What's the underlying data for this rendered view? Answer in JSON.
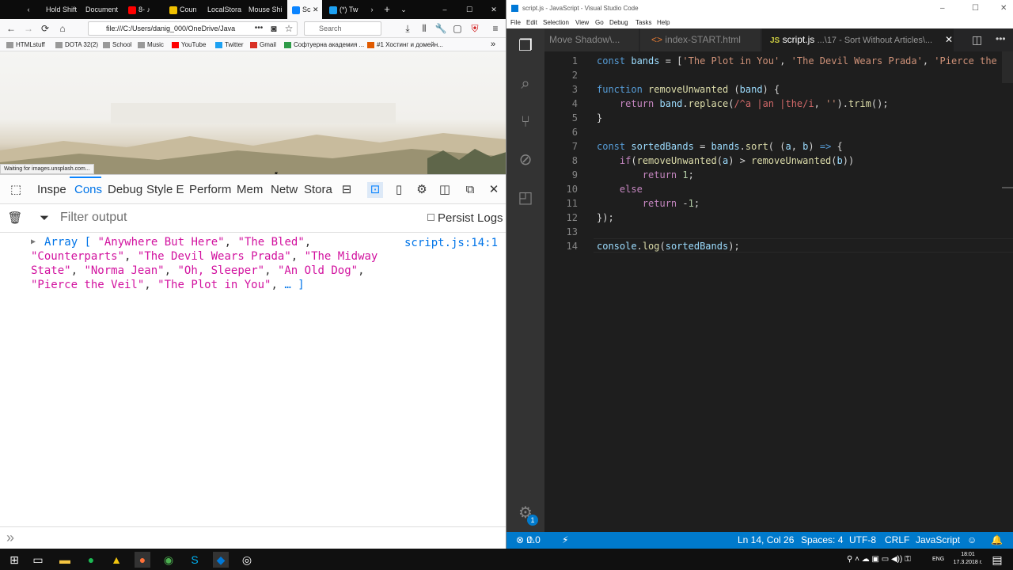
{
  "firefox": {
    "tabs": [
      {
        "label": "Hold Shift",
        "color": "#3c3c3c"
      },
      {
        "label": "Document",
        "color": "#3c3c3c"
      },
      {
        "label": "8-",
        "color": "#ff0000"
      },
      {
        "label": "Coun",
        "color": "#f0c000"
      },
      {
        "label": "LocalStora",
        "color": "#3c3c3c"
      },
      {
        "label": "Mouse Shi",
        "color": "#3c3c3c"
      },
      {
        "label": "Sc",
        "color": "#3c3c3c"
      },
      {
        "label": "(*) Tw",
        "color": "#1da1f2"
      }
    ],
    "url": "file:///C:/Users/danig_000/OneDrive/Java",
    "search_placeholder": "Search",
    "bookmarks": [
      "HTMLstuff",
      "DOTA 32(2)",
      "School",
      "Music",
      "YouTube",
      "Twitter",
      "Gmail",
      "Софтуерна академия ...",
      "#1 Хостинг и домейн..."
    ],
    "status_message": "Waiting for images.unsplash.com...",
    "devtools_tabs": [
      "Inspe",
      "Cons",
      "Debug",
      "Style E",
      "Perform",
      "Mem",
      "Netw",
      "Stora"
    ],
    "filter_placeholder": "Filter output",
    "persist_logs": "Persist Logs",
    "console_output": {
      "prefix": "Array [",
      "items": [
        "\"Anywhere But Here\"",
        "\"The Bled\"",
        "\"Counterparts\"",
        "\"The Devil Wears Prada\"",
        "\"The Midway",
        "State\"",
        "\"Norma Jean\"",
        "\"Oh, Sleeper\"",
        "\"An Old Dog\"",
        "\"Pierce the Veil\"",
        "\"The Plot in You\""
      ],
      "suffix": "… ]",
      "location": "script.js:14:1"
    },
    "prompt_symbol": "»"
  },
  "vscode": {
    "title": "script.js - JavaScript - Visual Studio Code",
    "menu": [
      "File",
      "Edit",
      "Selection",
      "View",
      "Go",
      "Debug",
      "Tasks",
      "Help"
    ],
    "tabs": [
      {
        "label": "Move Shadow\\..."
      },
      {
        "label": "index-START.html"
      },
      {
        "label": "script.js",
        "path": "...\\17 - Sort Without Articles\\..."
      }
    ],
    "line_numbers": [
      "1",
      "2",
      "3",
      "4",
      "5",
      "6",
      "7",
      "8",
      "9",
      "10",
      "11",
      "12",
      "13",
      "14"
    ],
    "status": {
      "errors": "0",
      "warnings": "0",
      "position": "Ln 14, Col 26",
      "spaces": "Spaces: 4",
      "encoding": "UTF-8",
      "eol": "CRLF",
      "language": "JavaScript"
    },
    "badge": "1"
  },
  "taskbar": {
    "language": "ENG",
    "time": "18:01",
    "date": "17.3.2018 г."
  }
}
